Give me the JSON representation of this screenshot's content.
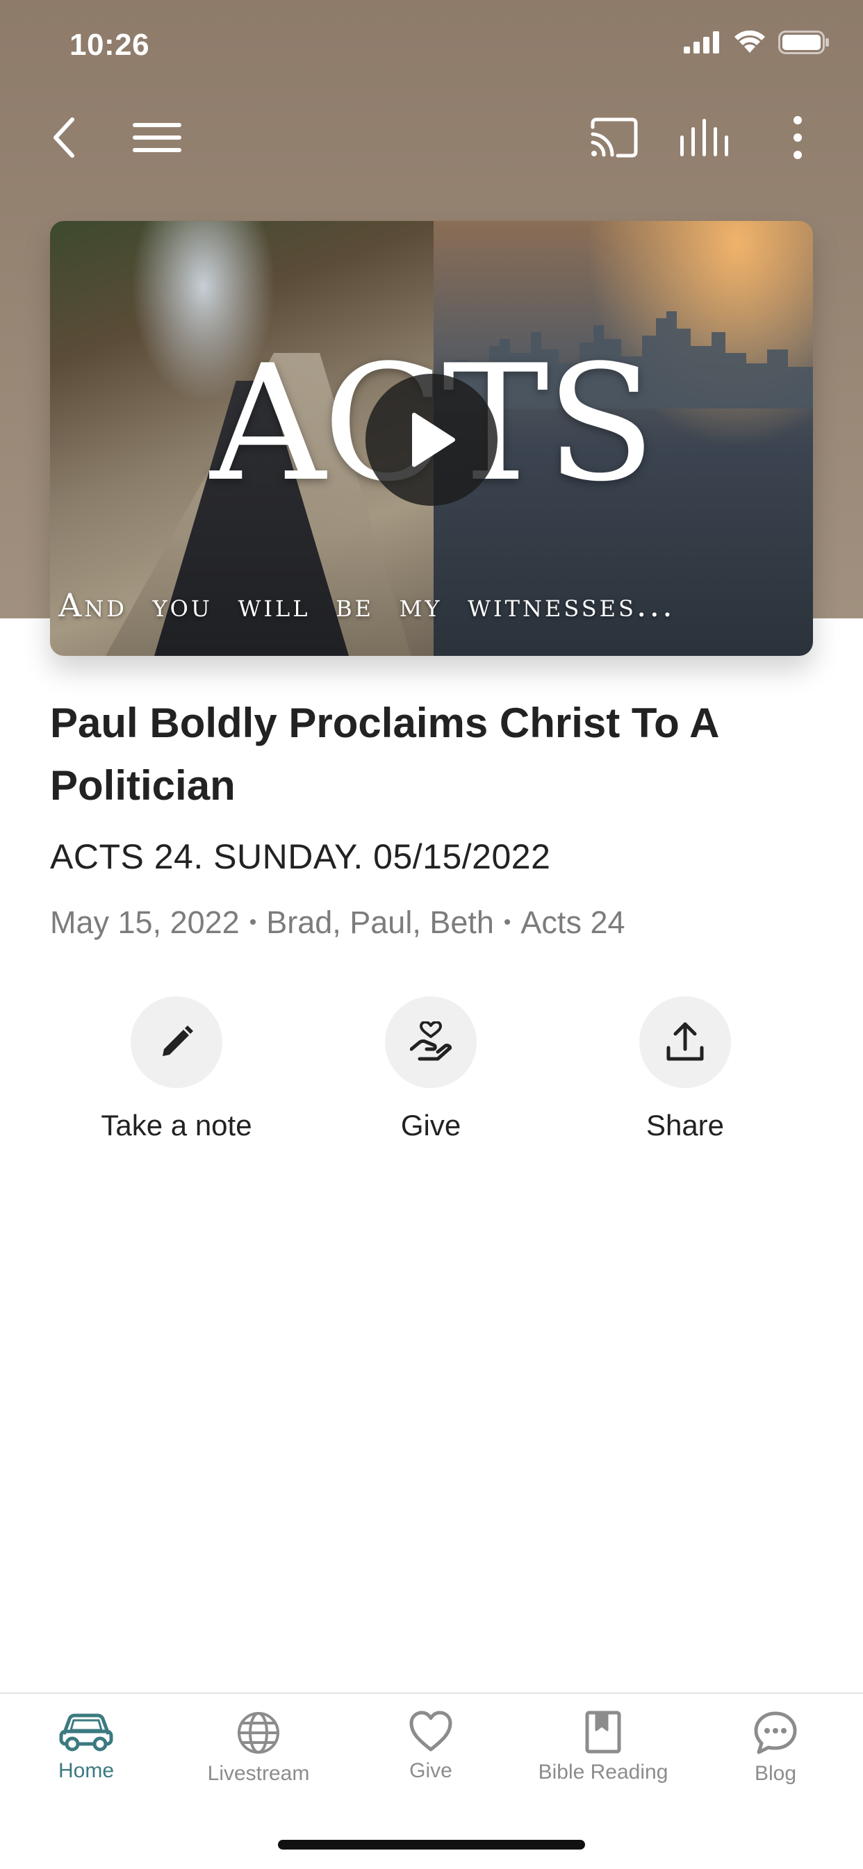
{
  "status_bar": {
    "time": "10:26"
  },
  "nav": {
    "icons": [
      "back-icon",
      "menu-icon",
      "cast-icon",
      "audio-bars-icon",
      "more-vertical-icon"
    ]
  },
  "hero": {
    "title_text": "ACTS",
    "caption": "And you will be my witnesses...",
    "play_icon": "play-icon"
  },
  "content": {
    "title": "Paul Boldly Proclaims Christ To A Politician",
    "subtitle": "ACTS 24. SUNDAY. 05/15/2022",
    "meta": {
      "date": "May 15, 2022",
      "speakers": "Brad, Paul, Beth",
      "passage": "Acts 24",
      "separator": "•"
    }
  },
  "actions": [
    {
      "label": "Take a note",
      "icon": "pencil-icon"
    },
    {
      "label": "Give",
      "icon": "hand-heart-icon"
    },
    {
      "label": "Share",
      "icon": "share-upload-icon"
    }
  ],
  "tab_bar": {
    "items": [
      {
        "label": "Home",
        "icon": "car-icon",
        "active": true
      },
      {
        "label": "Livestream",
        "icon": "globe-icon",
        "active": false
      },
      {
        "label": "Give",
        "icon": "heart-icon",
        "active": false
      },
      {
        "label": "Bible Reading",
        "icon": "bookmark-book-icon",
        "active": false
      },
      {
        "label": "Blog",
        "icon": "chat-bubble-icon",
        "active": false
      }
    ]
  },
  "colors": {
    "header_bg": "#8e7b6a",
    "accent": "#3b7a80",
    "inactive_tab": "#8c8c8c",
    "meta_text": "#7c7c7c"
  }
}
